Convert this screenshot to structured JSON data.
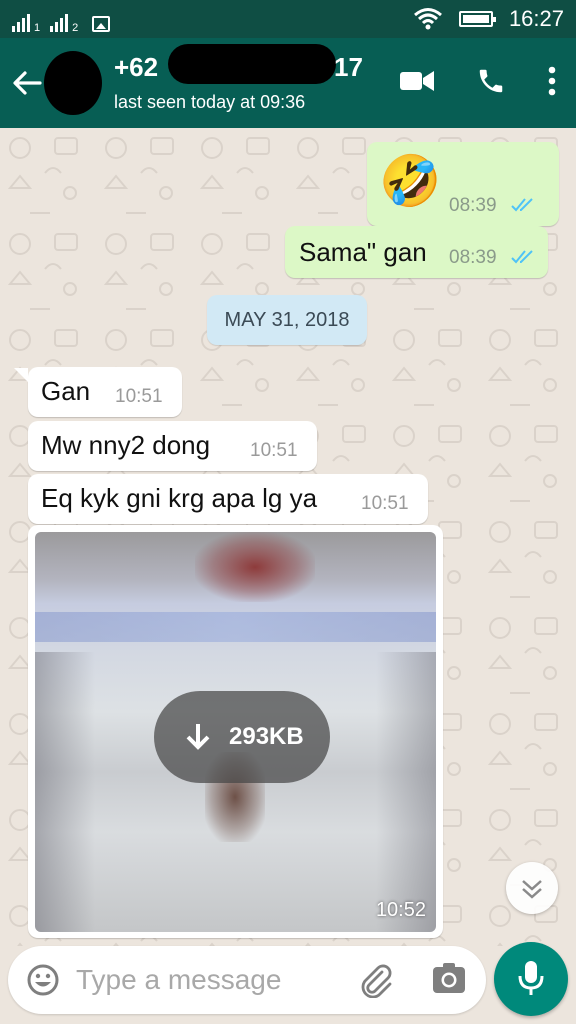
{
  "status_bar": {
    "sim1": "1",
    "sim2": "2",
    "time": "16:27"
  },
  "header": {
    "contact_prefix": "+62",
    "contact_suffix": "17",
    "last_seen": "last seen today at 09:36",
    "icons": [
      "back-arrow-icon",
      "video-call-icon",
      "phone-icon",
      "more-options-icon"
    ]
  },
  "messages": {
    "out_emoji": {
      "text": "🤣",
      "time": "08:39",
      "status": "read"
    },
    "out_text": {
      "text": "Sama\" gan",
      "time": "08:39",
      "status": "read"
    },
    "date_chip": "MAY 31, 2018",
    "in1": {
      "text": "Gan",
      "time": "10:51"
    },
    "in2": {
      "text": "Mw nny2 dong",
      "time": "10:51"
    },
    "in3": {
      "text": "Eq kyk gni krg apa lg ya",
      "time": "10:51"
    },
    "image": {
      "size": "293KB",
      "time": "10:52"
    }
  },
  "input": {
    "placeholder": "Type a message"
  },
  "colors": {
    "header": "#075e54",
    "status_bar": "#0f4e44",
    "outgoing": "#dcf8c6",
    "incoming": "#ffffff",
    "accent": "#00897b",
    "read_tick": "#4fc3f7"
  }
}
